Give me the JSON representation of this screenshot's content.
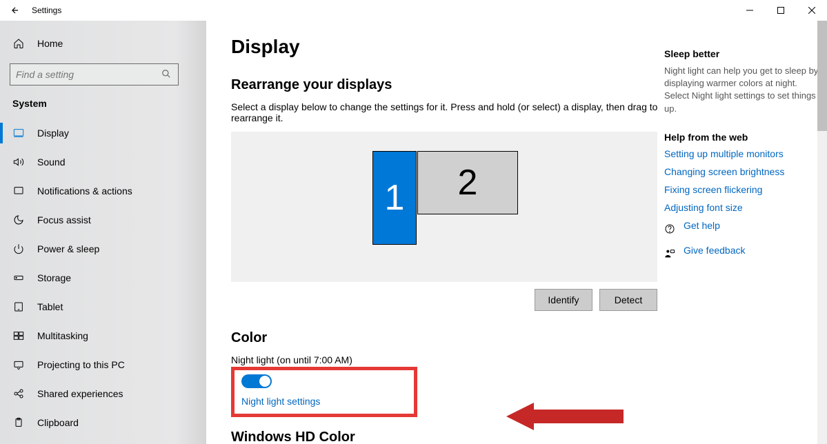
{
  "window": {
    "title": "Settings"
  },
  "sidebar": {
    "home": "Home",
    "search_placeholder": "Find a setting",
    "section": "System",
    "items": [
      {
        "label": "Display"
      },
      {
        "label": "Sound"
      },
      {
        "label": "Notifications & actions"
      },
      {
        "label": "Focus assist"
      },
      {
        "label": "Power & sleep"
      },
      {
        "label": "Storage"
      },
      {
        "label": "Tablet"
      },
      {
        "label": "Multitasking"
      },
      {
        "label": "Projecting to this PC"
      },
      {
        "label": "Shared experiences"
      },
      {
        "label": "Clipboard"
      }
    ]
  },
  "main": {
    "title": "Display",
    "rearrange": {
      "title": "Rearrange your displays",
      "instruction": "Select a display below to change the settings for it. Press and hold (or select) a display, then drag to rearrange it.",
      "monitor1": "1",
      "monitor2": "2",
      "identify": "Identify",
      "detect": "Detect"
    },
    "color": {
      "title": "Color",
      "night_light_label": "Night light (on until 7:00 AM)",
      "night_light_settings": "Night light settings"
    },
    "hd": {
      "title": "Windows HD Color"
    }
  },
  "right": {
    "sleep_title": "Sleep better",
    "sleep_text": "Night light can help you get to sleep by displaying warmer colors at night. Select Night light settings to set things up.",
    "help_title": "Help from the web",
    "links": [
      "Setting up multiple monitors",
      "Changing screen brightness",
      "Fixing screen flickering",
      "Adjusting font size"
    ],
    "get_help": "Get help",
    "feedback": "Give feedback"
  }
}
